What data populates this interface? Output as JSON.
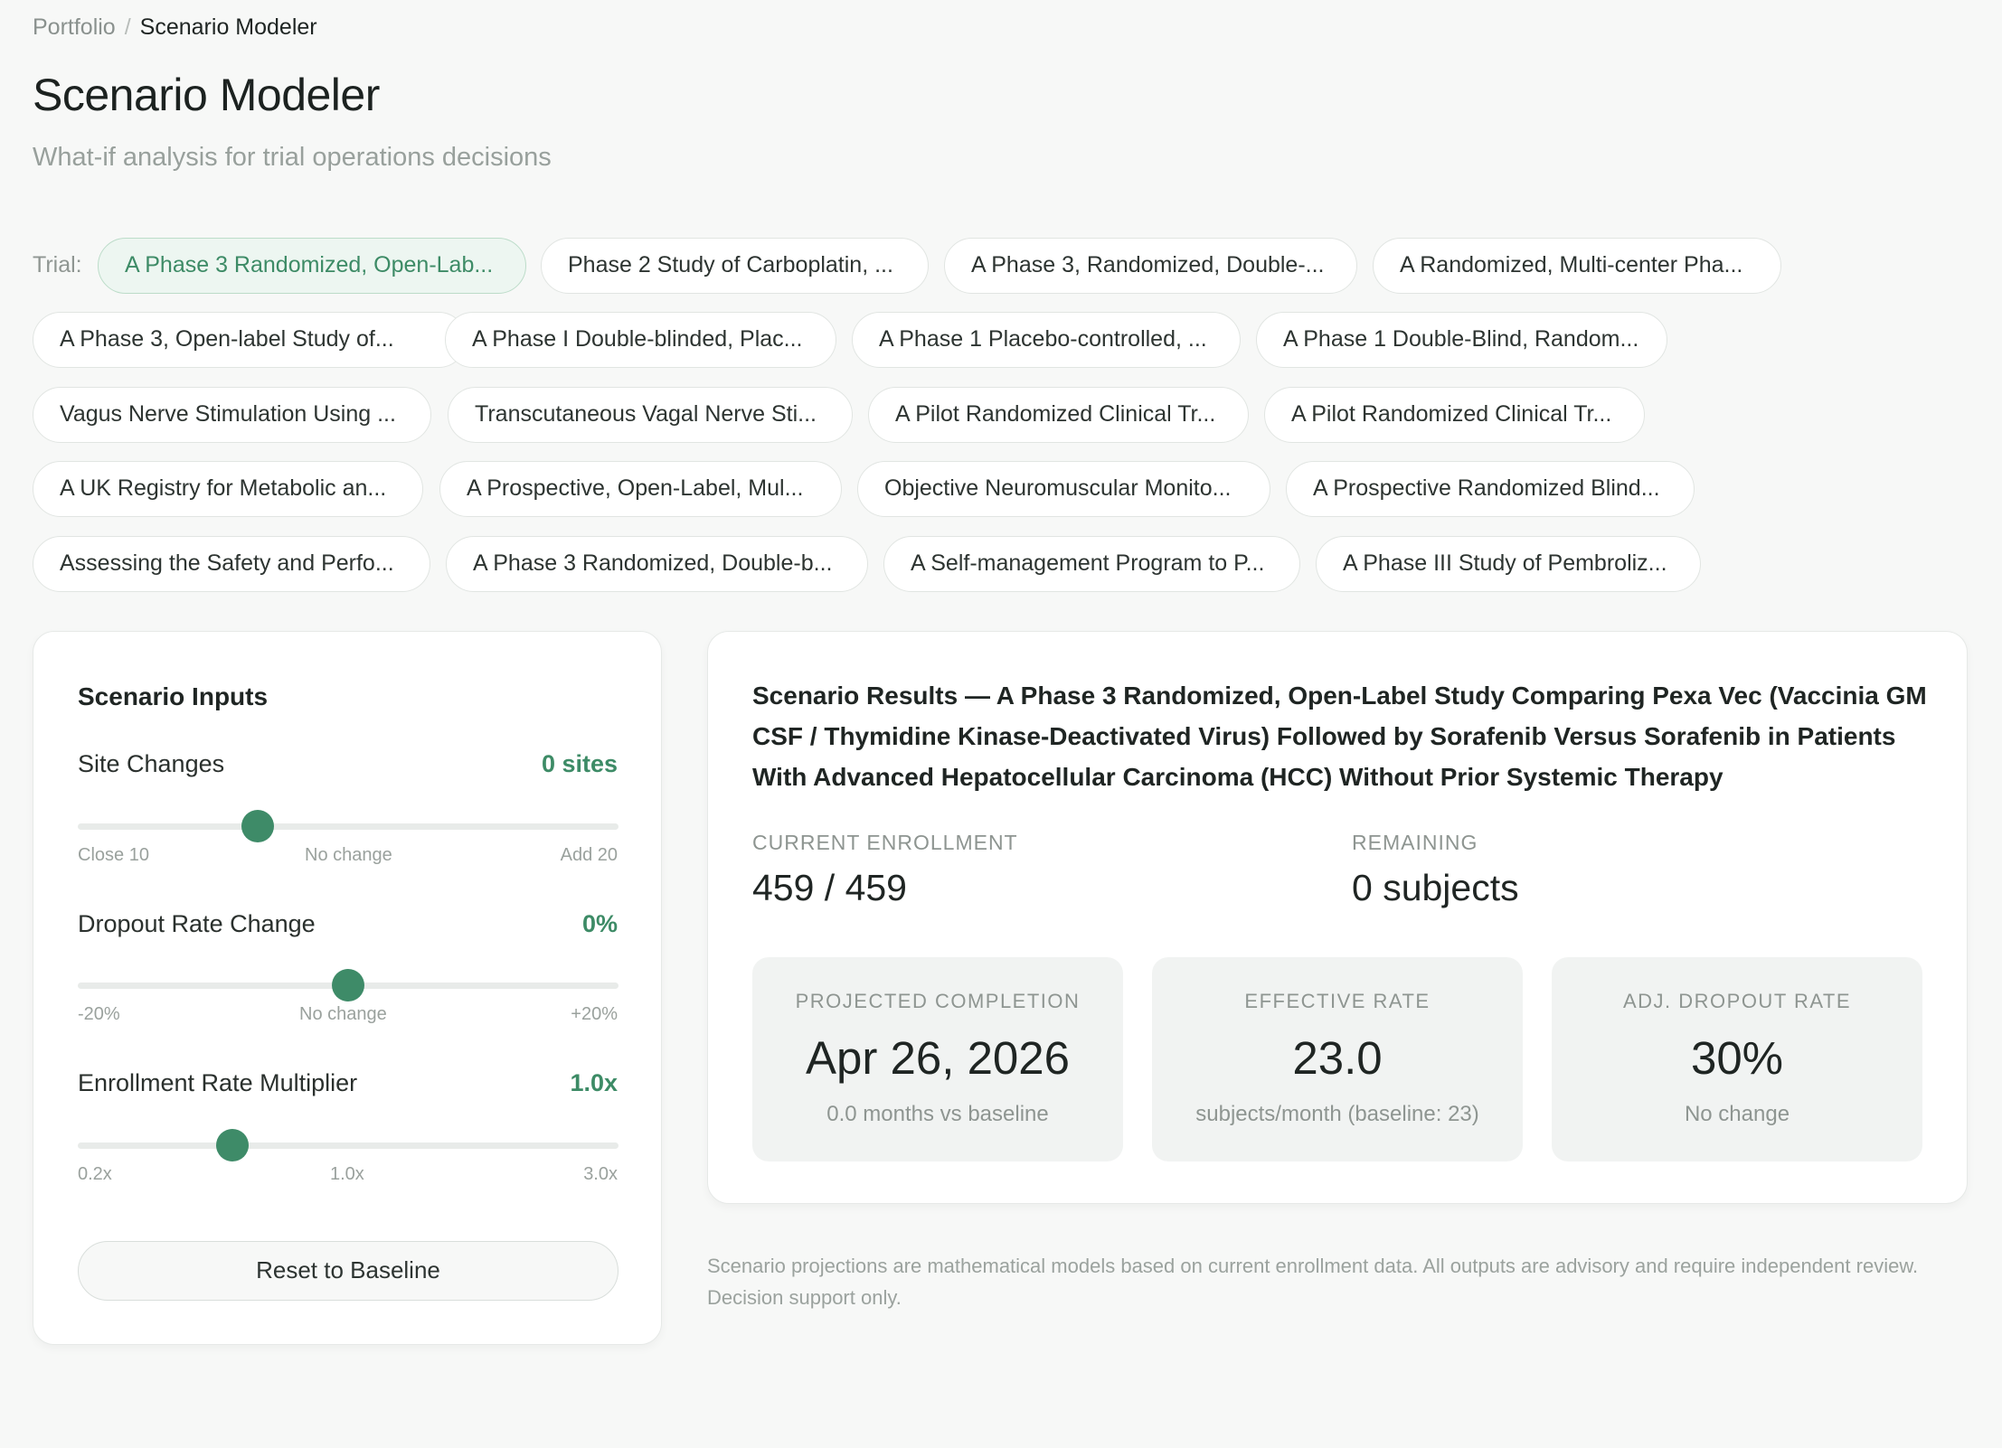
{
  "breadcrumb": {
    "root": "Portfolio",
    "separator": "/",
    "current": "Scenario Modeler"
  },
  "header": {
    "title": "Scenario Modeler",
    "subtitle": "What-if analysis for trial operations decisions"
  },
  "trials": {
    "label": "Trial:",
    "items": [
      "A Phase 3 Randomized, Open-Lab...",
      "Phase 2 Study of Carboplatin, ...",
      "A Phase 3, Randomized, Double-...",
      "A Randomized, Multi-center Pha...",
      "A Phase 3, Open-label Study of...",
      "A Phase I Double-blinded, Plac...",
      "A Phase 1 Placebo-controlled, ...",
      "A Phase 1 Double-Blind, Random...",
      "Vagus Nerve Stimulation Using ...",
      "Transcutaneous Vagal Nerve Sti...",
      "A Pilot Randomized Clinical Tr...",
      "A Pilot Randomized Clinical Tr...",
      "A UK Registry for Metabolic an...",
      "A Prospective, Open-Label, Mul...",
      "Objective Neuromuscular Monito...",
      "A Prospective Randomized Blind...",
      "Assessing the Safety and Perfo...",
      "A Phase 3 Randomized, Double-b...",
      "A Self-management Program to P...",
      "A Phase III Study of Pembroliz..."
    ],
    "selected_index": 0
  },
  "inputs": {
    "title": "Scenario Inputs",
    "site_changes": {
      "label": "Site Changes",
      "value": "0 sites",
      "min_label": "Close 10",
      "mid_label": "No change",
      "max_label": "Add 20",
      "min": -10,
      "max": 20,
      "current": 0
    },
    "dropout": {
      "label": "Dropout Rate Change",
      "value": "0%",
      "min_label": "-20%",
      "mid_label": "No change",
      "max_label": "+20%",
      "min": -20,
      "max": 20,
      "current": 0
    },
    "multiplier": {
      "label": "Enrollment Rate Multiplier",
      "value": "1.0x",
      "min_label": "0.2x",
      "mid_label": "1.0x",
      "max_label": "3.0x",
      "min": 0.2,
      "max": 3.0,
      "current": 1.0
    },
    "reset_label": "Reset to Baseline"
  },
  "results": {
    "title": "Scenario Results — A Phase 3 Randomized, Open-Label Study Comparing Pexa Vec (Vaccinia GM CSF / Thymidine Kinase-Deactivated Virus) Followed by Sorafenib Versus Sorafenib in Patients With Advanced Hepatocellular Carcinoma (HCC) Without Prior Systemic Therapy",
    "current_enrollment": {
      "label": "CURRENT ENROLLMENT",
      "value": "459 / 459"
    },
    "remaining": {
      "label": "REMAINING",
      "value": "0 subjects"
    },
    "kpis": [
      {
        "label": "PROJECTED COMPLETION",
        "value": "Apr 26, 2026",
        "sub": "0.0 months vs baseline"
      },
      {
        "label": "EFFECTIVE RATE",
        "value": "23.0",
        "sub": "subjects/month (baseline: 23)"
      },
      {
        "label": "ADJ. DROPOUT RATE",
        "value": "30%",
        "sub": "No change"
      }
    ]
  },
  "disclaimer": "Scenario projections are mathematical models based on current enrollment data. All outputs are advisory and require independent review. Decision support only.",
  "colors": {
    "accent": "#3e8b68",
    "active_chip_bg": "#edf6f1",
    "page_bg": "#f7f8f7"
  }
}
